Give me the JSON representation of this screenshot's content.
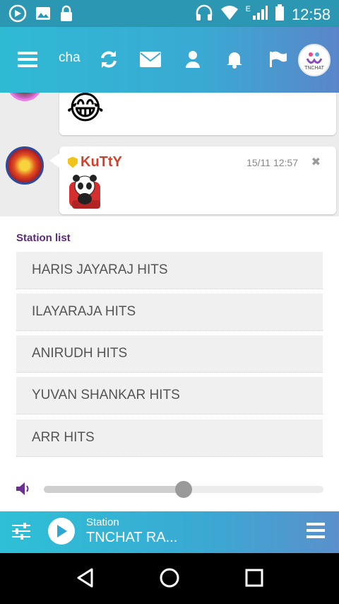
{
  "status_bar": {
    "time": "12:58",
    "network_type": "E",
    "icons": [
      "media-icon",
      "gallery-icon",
      "lock-icon",
      "headphones-icon",
      "wifi-icon",
      "signal-icon",
      "battery-icon"
    ]
  },
  "top_bar": {
    "title_truncated": "cha",
    "icons": [
      "menu-icon",
      "refresh-icon",
      "mail-icon",
      "user-icon",
      "bell-icon",
      "flag-icon"
    ],
    "logo_text": "TNCHAT"
  },
  "chat": {
    "messages": [
      {
        "emoji": "😂"
      },
      {
        "username": "KuTtY",
        "timestamp": "15/11 12:57",
        "sticker": "panda-sticker"
      }
    ]
  },
  "station_panel": {
    "title": "Station list",
    "stations": [
      "HARIS JAYARAJ HITS",
      "ILAYARAJA HITS",
      "ANIRUDH HITS",
      "YUVAN SHANKAR HITS",
      "ARR HITS"
    ],
    "volume_fraction": 0.5
  },
  "player": {
    "label": "Station",
    "station_name": "TNCHAT RA..."
  },
  "colors": {
    "accent": "#2fbad4",
    "panel_title": "#5a2a7a",
    "username": "#d0402d"
  }
}
